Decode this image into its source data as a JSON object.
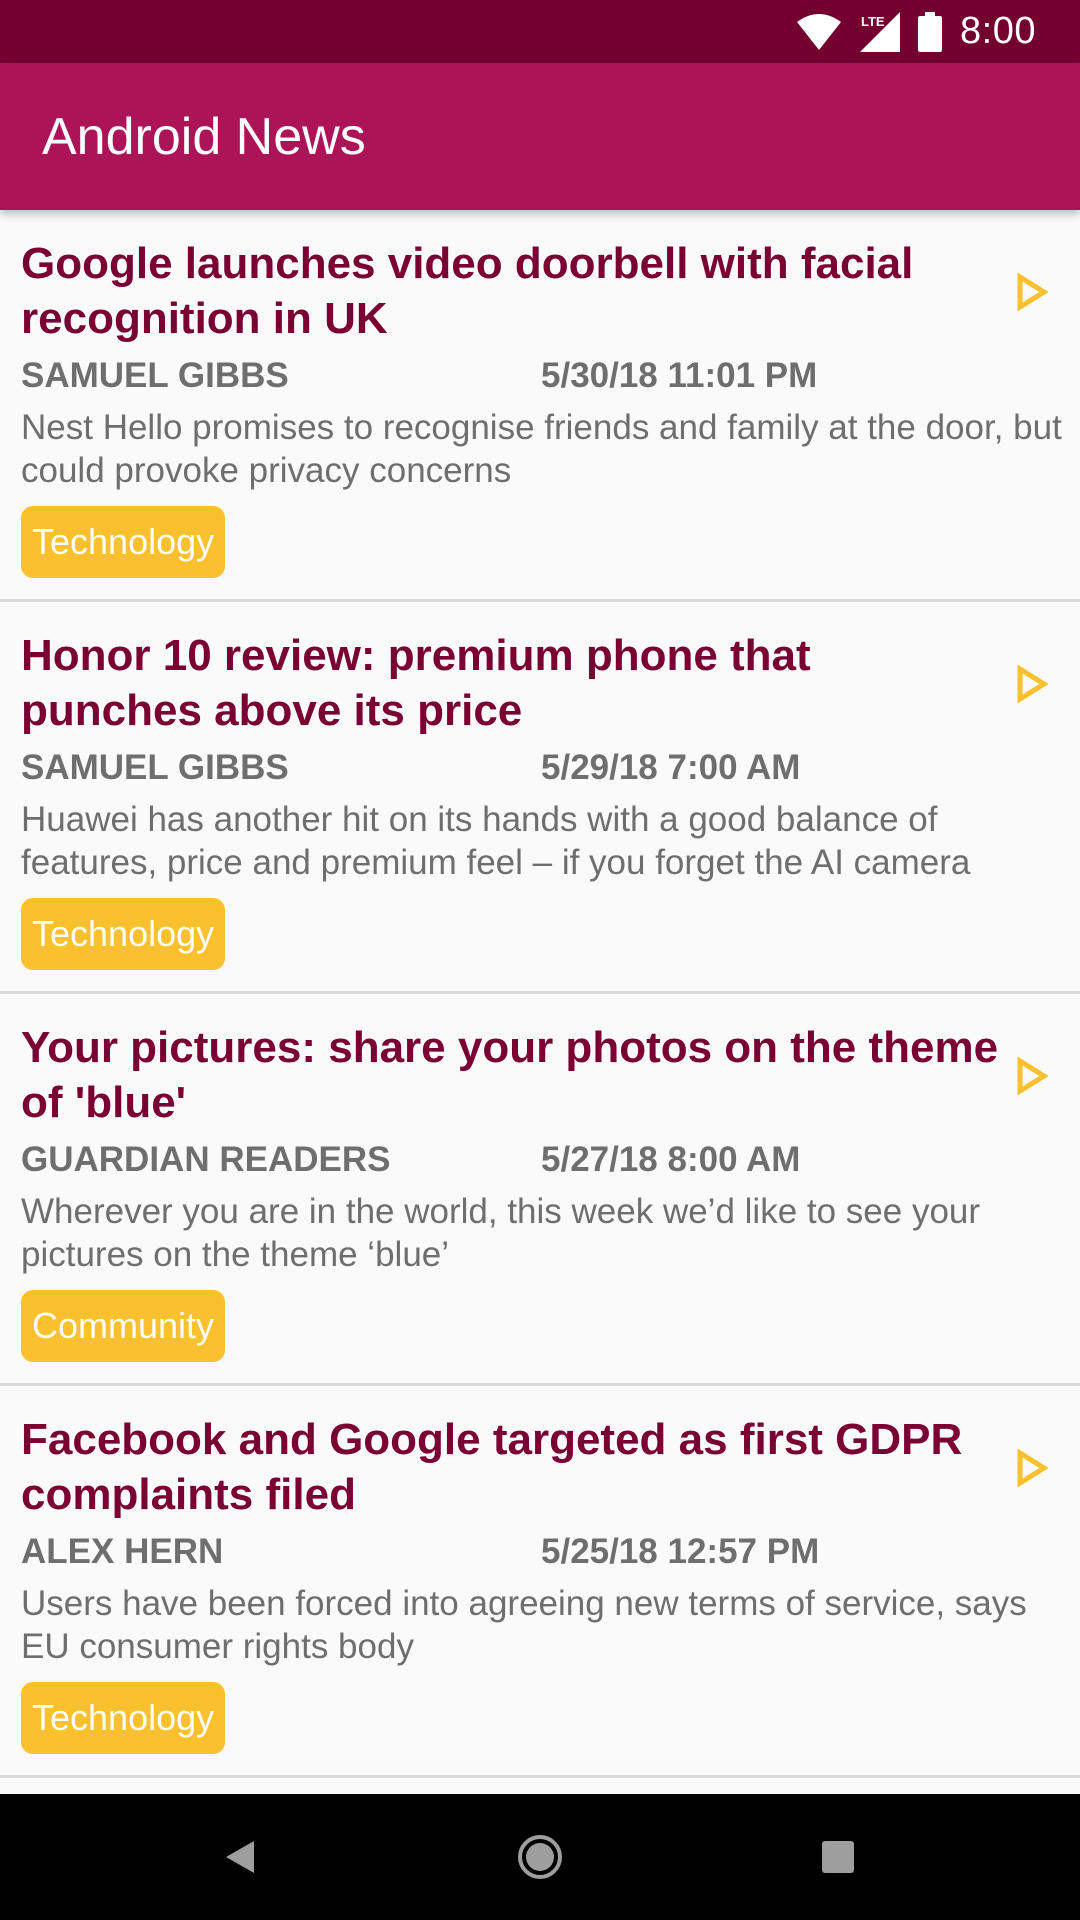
{
  "status_bar": {
    "time": "8:00",
    "network_label": "LTE",
    "icons": [
      "wifi-icon",
      "lte-signal-icon",
      "battery-icon"
    ]
  },
  "app_bar": {
    "title": "Android News"
  },
  "articles": [
    {
      "headline": "Google launches video doorbell with facial recognition in UK",
      "author": "SAMUEL GIBBS",
      "date": "5/30/18 11:01 PM",
      "summary": "Nest Hello promises to recognise friends and family at the door, but could provoke privacy concerns",
      "tag": "Technology"
    },
    {
      "headline": "Honor 10 review: premium phone that punches above its price",
      "author": "SAMUEL GIBBS",
      "date": "5/29/18 7:00 AM",
      "summary": "Huawei has another hit on its hands with a good balance of features, price and premium feel – if you forget the AI camera",
      "tag": "Technology"
    },
    {
      "headline": "Your pictures: share your photos on the theme of 'blue'",
      "author": "GUARDIAN READERS",
      "date": "5/27/18 8:00 AM",
      "summary": "Wherever you are in the world, this week we’d like to see your pictures on the theme ‘blue’",
      "tag": "Community"
    },
    {
      "headline": "Facebook and Google targeted as first GDPR complaints filed",
      "author": "ALEX HERN",
      "date": "5/25/18 12:57 PM",
      "summary": "Users have been forced into agreeing new terms of service, says EU consumer rights body",
      "tag": "Technology"
    }
  ],
  "nav_bar": {
    "buttons": [
      "back-icon",
      "home-icon",
      "recents-icon"
    ]
  },
  "colors": {
    "status_bar": "#740030",
    "app_bar": "#ad1457",
    "headline": "#7a0034",
    "tag": "#fbc02d",
    "arrow": "#fbc02d",
    "meta_text": "#6e6e6e"
  }
}
